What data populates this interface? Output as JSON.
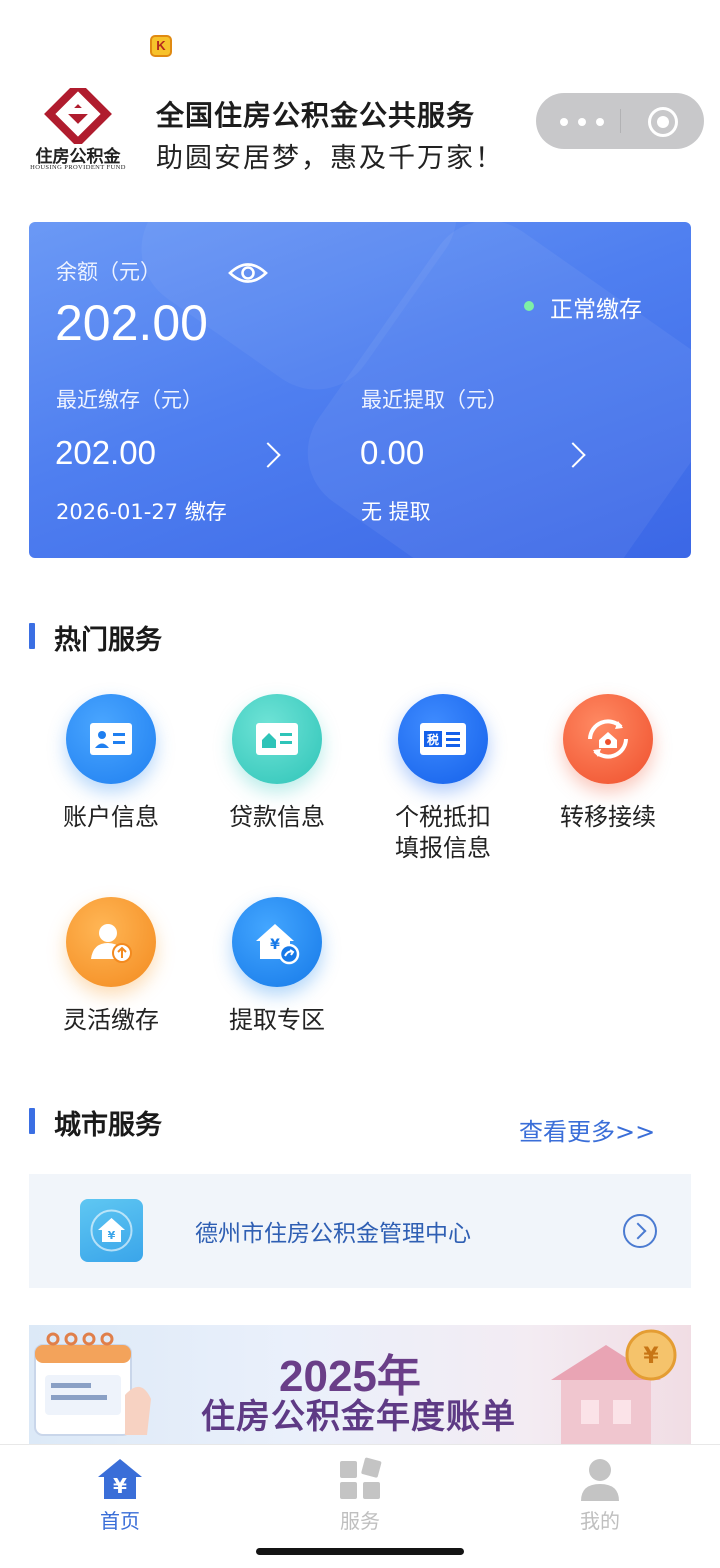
{
  "app": {
    "title": "全国住房公积金公共服务",
    "slogan": "助圆安居梦，惠及千万家！",
    "logo_name": "住房公积金",
    "logo_subtitle": "HOUSING PROVIDENT FUND",
    "badge_letter": "K"
  },
  "balance_card": {
    "balance_label": "余额（元）",
    "balance_value": "202.00",
    "status_text": "正常缴存",
    "recent_deposit_label": "最近缴存（元）",
    "recent_deposit_value": "202.00",
    "recent_deposit_date": "2026-01-27 缴存",
    "recent_withdraw_label": "最近提取（元）",
    "recent_withdraw_value": "0.00",
    "recent_withdraw_note": "无 提取"
  },
  "hot_services": {
    "title": "热门服务",
    "items": [
      {
        "label": "账户信息",
        "icon": "account-card-icon",
        "color": "#2f8df0"
      },
      {
        "label": "贷款信息",
        "icon": "loan-card-icon",
        "color": "#36c9bf"
      },
      {
        "label": "个税抵扣\n填报信息",
        "icon": "tax-card-icon",
        "color": "#1f6ef0"
      },
      {
        "label": "转移接续",
        "icon": "transfer-house-icon",
        "color": "#f25c3a"
      },
      {
        "label": "灵活缴存",
        "icon": "flexible-deposit-icon",
        "color": "#f59b2b"
      },
      {
        "label": "提取专区",
        "icon": "withdraw-house-icon",
        "color": "#1d88ee"
      }
    ]
  },
  "city_services": {
    "title": "城市服务",
    "more_label": "查看更多>>",
    "items": [
      {
        "label": "德州市住房公积金管理中心",
        "icon": "fund-center-house-icon"
      }
    ]
  },
  "banner": {
    "year_text": "2025年",
    "title_text": "住房公积金年度账单"
  },
  "tabbar": {
    "items": [
      {
        "label": "首页",
        "icon": "home-yuan-icon",
        "active": true,
        "color": "#3a6ed8"
      },
      {
        "label": "服务",
        "icon": "service-grid-icon",
        "active": false,
        "color": "#bfbfbf"
      },
      {
        "label": "我的",
        "icon": "profile-person-icon",
        "active": false,
        "color": "#bfbfbf"
      }
    ]
  }
}
